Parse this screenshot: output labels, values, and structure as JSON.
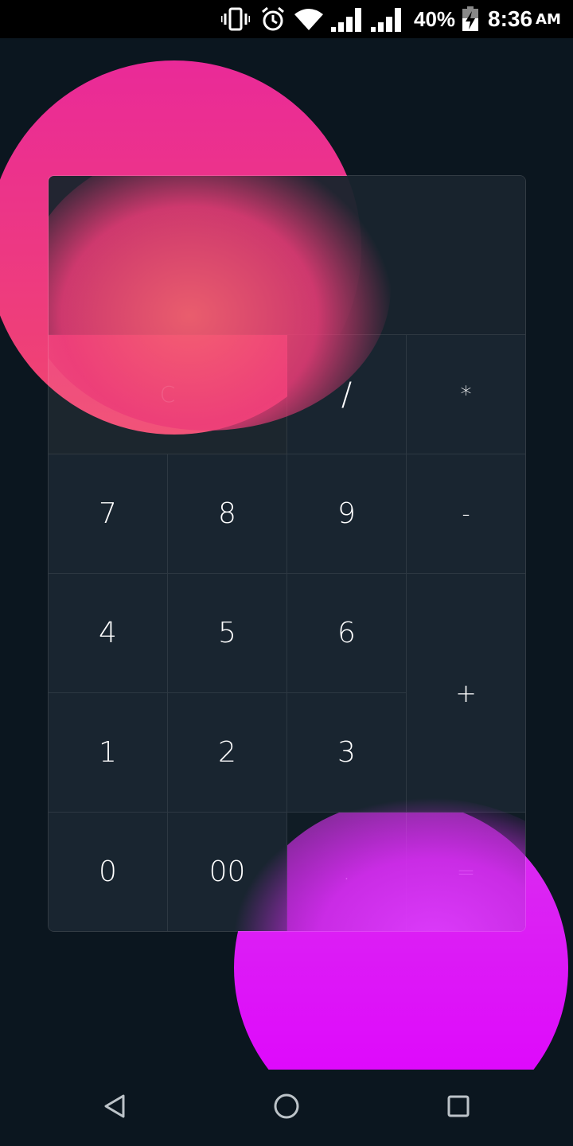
{
  "status_bar": {
    "battery_percent": "40%",
    "time": "8:36",
    "ampm": "AM",
    "icons": [
      "vibrate-icon",
      "alarm-icon",
      "wifi-icon",
      "signal-icon",
      "signal-icon",
      "battery-charging-icon"
    ]
  },
  "calculator": {
    "display_value": "",
    "keys": {
      "clear": "C",
      "divide": "/",
      "multiply": "*",
      "seven": "7",
      "eight": "8",
      "nine": "9",
      "minus": "-",
      "four": "4",
      "five": "5",
      "six": "6",
      "plus": "+",
      "one": "1",
      "two": "2",
      "three": "3",
      "zero": "0",
      "double_zero": "00",
      "decimal": ".",
      "equals": "="
    }
  },
  "colors": {
    "background": "#0b161f",
    "key_surface": "#192530",
    "pink_blob": "#ea2a98",
    "coral_blob": "#f0466e",
    "magenta_blob": "#e000ff"
  },
  "nav_bar": {
    "icons": [
      "back-icon",
      "home-icon",
      "recents-icon"
    ]
  }
}
